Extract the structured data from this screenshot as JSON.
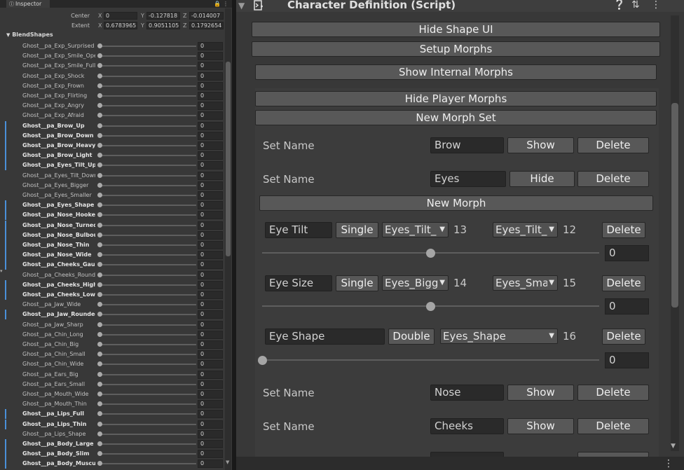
{
  "left_panel": {
    "tab_title": "Inspector",
    "bounds": {
      "center": {
        "label": "Center",
        "x": "0",
        "y": "-0.127818",
        "z": "-0.014007"
      },
      "extent": {
        "label": "Extent",
        "x": "0.6783965",
        "y": "0.9051105",
        "z": "0.1792654"
      }
    },
    "blendshapes_header": "BlendShapes",
    "blendshapes": [
      {
        "name": "Ghost__pa_Exp_Surprised",
        "value": "0",
        "bold": false
      },
      {
        "name": "Ghost__pa_Exp_Smile_Open",
        "value": "0",
        "bold": false
      },
      {
        "name": "Ghost__pa_Exp_Smile_Full",
        "value": "0",
        "bold": false
      },
      {
        "name": "Ghost__pa_Exp_Shock",
        "value": "0",
        "bold": false
      },
      {
        "name": "Ghost__pa_Exp_Frown",
        "value": "0",
        "bold": false
      },
      {
        "name": "Ghost__pa_Exp_Flirting",
        "value": "0",
        "bold": false
      },
      {
        "name": "Ghost__pa_Exp_Angry",
        "value": "0",
        "bold": false
      },
      {
        "name": "Ghost__pa_Exp_Afraid",
        "value": "0",
        "bold": false
      },
      {
        "name": "Ghost__pa_Brow_Up",
        "value": "0",
        "bold": true
      },
      {
        "name": "Ghost__pa_Brow_Down",
        "value": "0",
        "bold": true
      },
      {
        "name": "Ghost__pa_Brow_Heavy",
        "value": "0",
        "bold": true
      },
      {
        "name": "Ghost__pa_Brow_Light",
        "value": "0",
        "bold": true
      },
      {
        "name": "Ghost__pa_Eyes_Tilt_Up",
        "value": "0",
        "bold": true
      },
      {
        "name": "Ghost__pa_Eyes_Tilt_Down",
        "value": "0",
        "bold": false
      },
      {
        "name": "Ghost__pa_Eyes_Bigger",
        "value": "0",
        "bold": false
      },
      {
        "name": "Ghost__pa_Eyes_Smaller",
        "value": "0",
        "bold": false
      },
      {
        "name": "Ghost__pa_Eyes_Shape",
        "value": "0",
        "bold": true
      },
      {
        "name": "Ghost__pa_Nose_Hooked",
        "value": "0",
        "bold": true
      },
      {
        "name": "Ghost__pa_Nose_Turned_Up",
        "value": "0",
        "bold": true
      },
      {
        "name": "Ghost__pa_Nose_Bulbous",
        "value": "0",
        "bold": true
      },
      {
        "name": "Ghost__pa_Nose_Thin",
        "value": "0",
        "bold": true
      },
      {
        "name": "Ghost__pa_Nose_Wide",
        "value": "0",
        "bold": true
      },
      {
        "name": "Ghost__pa_Cheeks_Gaunt",
        "value": "0",
        "bold": true
      },
      {
        "name": "Ghost__pa_Cheeks_Round",
        "value": "0",
        "bold": false
      },
      {
        "name": "Ghost__pa_Cheeks_High",
        "value": "0",
        "bold": true
      },
      {
        "name": "Ghost__pa_Cheeks_Low",
        "value": "0",
        "bold": true
      },
      {
        "name": "Ghost__pa_Jaw_Wide",
        "value": "0",
        "bold": false
      },
      {
        "name": "Ghost__pa_Jaw_Rounded",
        "value": "0",
        "bold": true
      },
      {
        "name": "Ghost__pa_Jaw_Sharp",
        "value": "0",
        "bold": false
      },
      {
        "name": "Ghost__pa_Chin_Long",
        "value": "0",
        "bold": false
      },
      {
        "name": "Ghost__pa_Chin_Big",
        "value": "0",
        "bold": false
      },
      {
        "name": "Ghost__pa_Chin_Small",
        "value": "0",
        "bold": false
      },
      {
        "name": "Ghost__pa_Chin_Wide",
        "value": "0",
        "bold": false
      },
      {
        "name": "Ghost__pa_Ears_Big",
        "value": "0",
        "bold": false
      },
      {
        "name": "Ghost__pa_Ears_Small",
        "value": "0",
        "bold": false
      },
      {
        "name": "Ghost__pa_Mouth_Wide",
        "value": "0",
        "bold": false
      },
      {
        "name": "Ghost__pa_Mouth_Thin",
        "value": "0",
        "bold": false
      },
      {
        "name": "Ghost__pa_Lips_Full",
        "value": "0",
        "bold": true
      },
      {
        "name": "Ghost__pa_Lips_Thin",
        "value": "0",
        "bold": true
      },
      {
        "name": "Ghost__pa_Lips_Shape",
        "value": "0",
        "bold": false
      },
      {
        "name": "Ghost__pa_Body_Large",
        "value": "0",
        "bold": true
      },
      {
        "name": "Ghost__pa_Body_Slim",
        "value": "0",
        "bold": true
      },
      {
        "name": "Ghost__pa_Body_Muscular",
        "value": "0",
        "bold": true
      }
    ]
  },
  "component": {
    "title": "Character Definition (Script)",
    "hide_shape_ui": "Hide Shape UI",
    "setup_morphs": "Setup Morphs",
    "show_internal_morphs": "Show Internal Morphs",
    "hide_player_morphs": "Hide Player Morphs",
    "new_morph_set": "New Morph Set",
    "set_name_label": "Set Name",
    "new_morph": "New Morph",
    "delete_label": "Delete",
    "sets": {
      "brow": {
        "name": "Brow",
        "toggle": "Show"
      },
      "eyes": {
        "name": "Eyes",
        "toggle": "Hide"
      },
      "nose": {
        "name": "Nose",
        "toggle": "Show"
      },
      "cheeks": {
        "name": "Cheeks",
        "toggle": "Show"
      }
    },
    "morphs": {
      "eye_tilt": {
        "name": "Eye Tilt",
        "mode": "Single",
        "a_shape": "Eyes_Tilt_",
        "a_index": "13",
        "b_shape": "Eyes_Tilt_",
        "b_index": "12",
        "value": "0",
        "slider_level": 0.5
      },
      "eye_size": {
        "name": "Eye Size",
        "mode": "Single",
        "a_shape": "Eyes_Bigg",
        "a_index": "14",
        "b_shape": "Eyes_Sma",
        "b_index": "15",
        "value": "0",
        "slider_level": 0.5
      },
      "eye_shape": {
        "name": "Eye Shape",
        "mode": "Double",
        "a_shape": "Eyes_Shape",
        "a_index": "16",
        "value": "0",
        "slider_level": 0.0
      }
    }
  }
}
